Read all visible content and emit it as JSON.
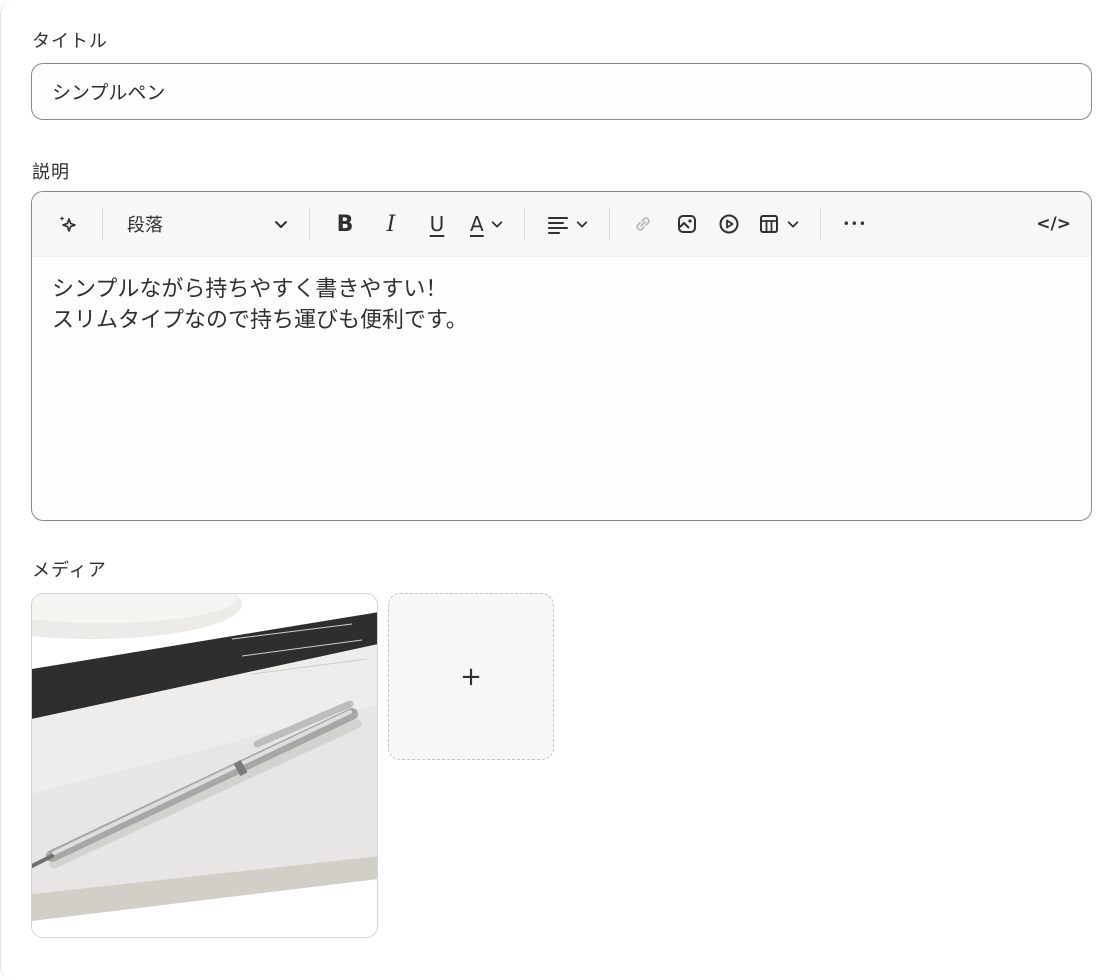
{
  "title_field": {
    "label": "タイトル",
    "value": "シンプルペン"
  },
  "description_field": {
    "label": "説明",
    "toolbar": {
      "paragraph_select": "段落",
      "bold": "B",
      "italic": "I",
      "underline": "U",
      "text_color": "A",
      "more": "•••",
      "code": "</>"
    },
    "lines": [
      "シンプルながら持ちやすく書きやすい！",
      "スリムタイプなので持ち運びも便利です。"
    ]
  },
  "media_field": {
    "label": "メディア",
    "add_label": "+"
  },
  "colors": {
    "border": "#8a8a8a",
    "toolbar_bg": "#f7f7f7",
    "text": "#303030"
  }
}
